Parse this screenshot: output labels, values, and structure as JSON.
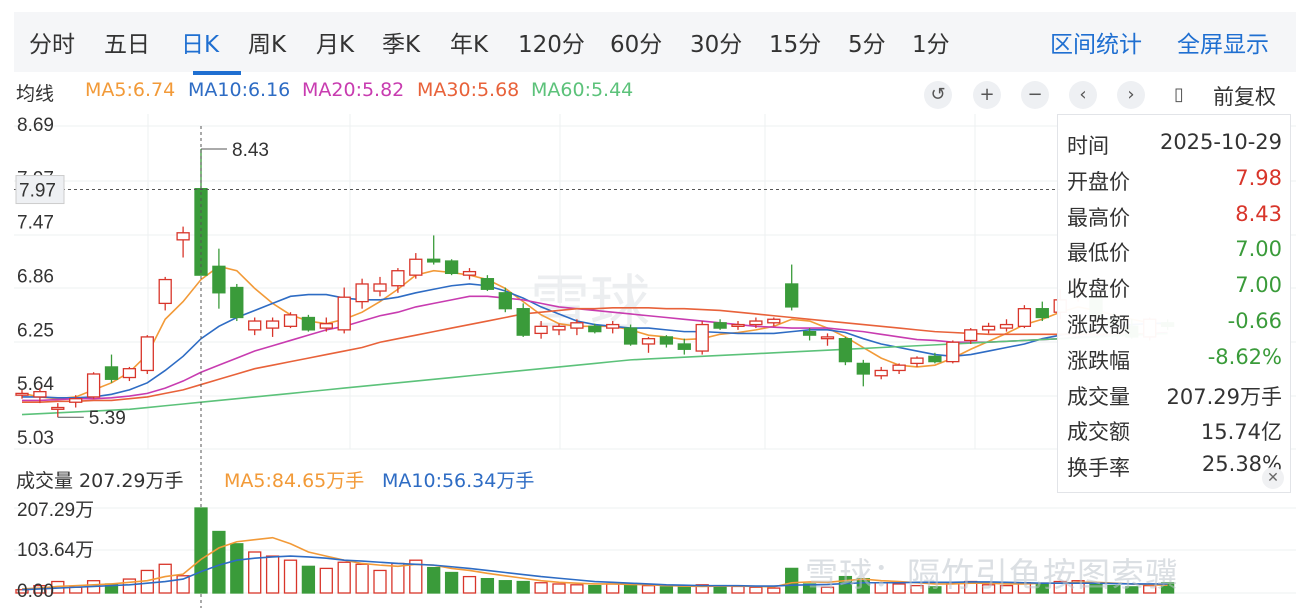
{
  "tabs": [
    "分时",
    "五日",
    "日K",
    "周K",
    "月K",
    "季K",
    "年K",
    "120分",
    "60分",
    "30分",
    "15分",
    "5分",
    "1分"
  ],
  "active_tab": "日K",
  "right_tabs": [
    "区间统计",
    "全屏显示"
  ],
  "ma_line": {
    "label": "均线",
    "ma5": "MA5:6.74",
    "ma10": "MA10:6.16",
    "ma20": "MA20:5.82",
    "ma30": "MA30:5.68",
    "ma60": "MA60:5.44"
  },
  "controls": [
    "undo-icon",
    "zoom-in-icon",
    "zoom-out-icon",
    "chevron-left-icon",
    "chevron-right-icon",
    "candle-icon"
  ],
  "adjust_label": "前复权",
  "volume_row": {
    "label": "成交量 207.29万手",
    "ma5": "MA5:84.65万手",
    "ma10": "MA10:56.34万手"
  },
  "info_panel": {
    "rows": [
      {
        "k": "时间",
        "v": "2025-10-29",
        "c": "#333333"
      },
      {
        "k": "开盘价",
        "v": "7.98",
        "c": "#d8352a"
      },
      {
        "k": "最高价",
        "v": "8.43",
        "c": "#d8352a"
      },
      {
        "k": "最低价",
        "v": "7.00",
        "c": "#3a9b3a"
      },
      {
        "k": "收盘价",
        "v": "7.00",
        "c": "#3a9b3a"
      },
      {
        "k": "涨跌额",
        "v": "-0.66",
        "c": "#3a9b3a"
      },
      {
        "k": "涨跌幅",
        "v": "-8.62%",
        "c": "#3a9b3a"
      },
      {
        "k": "成交量",
        "v": "207.29万手",
        "c": "#333333"
      },
      {
        "k": "成交额",
        "v": "15.74亿",
        "c": "#333333"
      },
      {
        "k": "换手率",
        "v": "25.38%",
        "c": "#333333"
      }
    ]
  },
  "watermark": "雪球：隔竹引龟按图索骥",
  "watermark_logo": "雪球",
  "colors": {
    "up": "#d8352a",
    "down": "#3a9b3a",
    "accent": "#1f6fd1",
    "ma5": "#f29a38",
    "ma10": "#2e6cc4",
    "ma20": "#c83cb0",
    "ma30": "#e8623a",
    "ma60": "#5cc27a"
  },
  "chart_data": {
    "type": "candlestick",
    "price_axis": {
      "ticks": [
        8.69,
        7.97,
        7.47,
        6.86,
        6.25,
        5.64,
        5.03
      ],
      "ylim": [
        5.03,
        8.69
      ]
    },
    "volume_axis": {
      "ticks": [
        "207.29万",
        "103.64万",
        "0.00"
      ],
      "ylim": [
        0,
        207.29
      ]
    },
    "annotations": {
      "max_label": "8.43",
      "min_label": "5.39",
      "crosshair_price": "7.97"
    },
    "candles": [
      [
        5.64,
        5.7,
        5.6,
        5.66
      ],
      [
        5.62,
        5.72,
        5.55,
        5.68
      ],
      [
        5.48,
        5.55,
        5.39,
        5.5
      ],
      [
        5.56,
        5.64,
        5.5,
        5.6
      ],
      [
        5.62,
        5.9,
        5.6,
        5.88
      ],
      [
        5.96,
        6.1,
        5.78,
        5.82
      ],
      [
        5.84,
        5.96,
        5.8,
        5.94
      ],
      [
        5.92,
        6.32,
        5.88,
        6.3
      ],
      [
        6.68,
        6.98,
        6.6,
        6.95
      ],
      [
        7.4,
        7.55,
        7.2,
        7.48
      ],
      [
        7.98,
        8.43,
        7.0,
        7.0
      ],
      [
        7.1,
        7.3,
        6.62,
        6.8
      ],
      [
        6.86,
        6.9,
        6.48,
        6.52
      ],
      [
        6.38,
        6.52,
        6.32,
        6.48
      ],
      [
        6.4,
        6.52,
        6.3,
        6.48
      ],
      [
        6.42,
        6.58,
        6.4,
        6.55
      ],
      [
        6.52,
        6.55,
        6.36,
        6.38
      ],
      [
        6.4,
        6.52,
        6.36,
        6.45
      ],
      [
        6.38,
        6.86,
        6.34,
        6.75
      ],
      [
        6.7,
        6.96,
        6.62,
        6.9
      ],
      [
        6.82,
        6.98,
        6.76,
        6.9
      ],
      [
        6.88,
        7.08,
        6.8,
        7.05
      ],
      [
        7.0,
        7.25,
        6.96,
        7.18
      ],
      [
        7.18,
        7.45,
        7.12,
        7.15
      ],
      [
        7.16,
        7.18,
        7.0,
        7.02
      ],
      [
        7.0,
        7.08,
        6.95,
        7.04
      ],
      [
        6.96,
        7.0,
        6.82,
        6.84
      ],
      [
        6.8,
        6.86,
        6.58,
        6.62
      ],
      [
        6.62,
        6.68,
        6.3,
        6.32
      ],
      [
        6.34,
        6.48,
        6.28,
        6.42
      ],
      [
        6.38,
        6.45,
        6.32,
        6.42
      ],
      [
        6.4,
        6.5,
        6.32,
        6.46
      ],
      [
        6.42,
        6.45,
        6.34,
        6.36
      ],
      [
        6.4,
        6.48,
        6.34,
        6.44
      ],
      [
        6.4,
        6.44,
        6.2,
        6.22
      ],
      [
        6.22,
        6.3,
        6.12,
        6.28
      ],
      [
        6.3,
        6.32,
        6.18,
        6.22
      ],
      [
        6.22,
        6.28,
        6.1,
        6.16
      ],
      [
        6.14,
        6.48,
        6.1,
        6.44
      ],
      [
        6.46,
        6.5,
        6.38,
        6.4
      ],
      [
        6.42,
        6.48,
        6.38,
        6.44
      ],
      [
        6.44,
        6.52,
        6.4,
        6.48
      ],
      [
        6.46,
        6.52,
        6.42,
        6.5
      ],
      [
        6.9,
        7.12,
        6.6,
        6.64
      ],
      [
        6.36,
        6.4,
        6.26,
        6.32
      ],
      [
        6.28,
        6.34,
        6.2,
        6.3
      ],
      [
        6.28,
        6.3,
        5.98,
        6.02
      ],
      [
        6.0,
        6.04,
        5.74,
        5.88
      ],
      [
        5.86,
        5.96,
        5.82,
        5.92
      ],
      [
        5.92,
        6.0,
        5.88,
        5.98
      ],
      [
        6.0,
        6.08,
        5.96,
        6.06
      ],
      [
        6.08,
        6.12,
        6.0,
        6.02
      ],
      [
        6.02,
        6.26,
        6.0,
        6.24
      ],
      [
        6.26,
        6.4,
        6.22,
        6.38
      ],
      [
        6.38,
        6.46,
        6.34,
        6.42
      ],
      [
        6.4,
        6.5,
        6.36,
        6.44
      ],
      [
        6.42,
        6.66,
        6.4,
        6.62
      ],
      [
        6.62,
        6.7,
        6.48,
        6.52
      ],
      [
        6.58,
        6.84,
        6.5,
        6.72
      ],
      [
        6.8,
        6.96,
        6.7,
        6.92
      ],
      [
        6.76,
        6.8,
        6.46,
        6.52
      ],
      [
        6.5,
        6.58,
        6.42,
        6.44
      ],
      [
        6.42,
        6.5,
        6.28,
        6.3
      ],
      [
        6.3,
        6.52,
        6.26,
        6.5
      ],
      [
        6.46,
        6.5,
        6.38,
        6.42
      ]
    ],
    "volumes": [
      8,
      18,
      28,
      14,
      30,
      22,
      34,
      55,
      70,
      42,
      207.29,
      150,
      120,
      100,
      90,
      80,
      65,
      60,
      75,
      70,
      55,
      72,
      80,
      62,
      50,
      40,
      35,
      30,
      28,
      25,
      22,
      20,
      18,
      22,
      20,
      18,
      15,
      14,
      20,
      18,
      16,
      14,
      12,
      60,
      22,
      14,
      40,
      35,
      25,
      22,
      18,
      15,
      24,
      28,
      20,
      18,
      25,
      22,
      28,
      30,
      22,
      18,
      15,
      18,
      25
    ],
    "ma_series": {
      "MA5": [
        5.66,
        5.62,
        5.6,
        5.62,
        5.7,
        5.78,
        5.9,
        6.1,
        6.5,
        6.7,
        6.95,
        7.1,
        7.05,
        6.85,
        6.68,
        6.55,
        6.48,
        6.45,
        6.5,
        6.58,
        6.7,
        6.84,
        7.0,
        7.05,
        7.03,
        7.0,
        6.95,
        6.85,
        6.7,
        6.55,
        6.45,
        6.42,
        6.42,
        6.42,
        6.38,
        6.32,
        6.3,
        6.27,
        6.28,
        6.33,
        6.35,
        6.38,
        6.42,
        6.5,
        6.48,
        6.4,
        6.3,
        6.18,
        6.06,
        5.98,
        5.96,
        5.98,
        6.06,
        6.16,
        6.25,
        6.34,
        6.44,
        6.5,
        6.58,
        6.64,
        6.6,
        6.55,
        6.5,
        6.46,
        6.44
      ],
      "MA10": [
        5.62,
        5.62,
        5.61,
        5.61,
        5.62,
        5.65,
        5.7,
        5.78,
        5.92,
        6.08,
        6.28,
        6.42,
        6.52,
        6.6,
        6.68,
        6.76,
        6.78,
        6.78,
        6.74,
        6.72,
        6.72,
        6.75,
        6.8,
        6.84,
        6.88,
        6.9,
        6.88,
        6.82,
        6.74,
        6.64,
        6.56,
        6.48,
        6.44,
        6.42,
        6.4,
        6.4,
        6.38,
        6.36,
        6.36,
        6.35,
        6.34,
        6.34,
        6.34,
        6.36,
        6.38,
        6.38,
        6.35,
        6.28,
        6.22,
        6.18,
        6.14,
        6.1,
        6.08,
        6.1,
        6.14,
        6.18,
        6.22,
        6.28,
        6.32,
        6.36,
        6.4,
        6.42,
        6.44,
        6.45,
        6.46
      ],
      "MA20": [
        5.58,
        5.58,
        5.59,
        5.6,
        5.6,
        5.61,
        5.63,
        5.66,
        5.72,
        5.8,
        5.9,
        5.98,
        6.06,
        6.14,
        6.2,
        6.26,
        6.32,
        6.38,
        6.42,
        6.48,
        6.54,
        6.58,
        6.64,
        6.68,
        6.72,
        6.76,
        6.76,
        6.74,
        6.72,
        6.68,
        6.64,
        6.62,
        6.6,
        6.58,
        6.56,
        6.54,
        6.52,
        6.5,
        6.48,
        6.46,
        6.44,
        6.42,
        6.41,
        6.4,
        6.4,
        6.4,
        6.38,
        6.36,
        6.33,
        6.3,
        6.27,
        6.26,
        6.24,
        6.24,
        6.24,
        6.25,
        6.26,
        6.27,
        6.28,
        6.3,
        6.31,
        6.32,
        6.33,
        6.34,
        6.35
      ],
      "MA30": [
        5.56,
        5.56,
        5.57,
        5.57,
        5.58,
        5.58,
        5.6,
        5.62,
        5.66,
        5.7,
        5.76,
        5.82,
        5.88,
        5.94,
        5.98,
        6.02,
        6.06,
        6.1,
        6.14,
        6.18,
        6.24,
        6.28,
        6.32,
        6.36,
        6.4,
        6.44,
        6.48,
        6.52,
        6.56,
        6.58,
        6.6,
        6.62,
        6.62,
        6.63,
        6.63,
        6.63,
        6.62,
        6.62,
        6.61,
        6.6,
        6.58,
        6.56,
        6.54,
        6.52,
        6.5,
        6.48,
        6.46,
        6.44,
        6.42,
        6.4,
        6.38,
        6.36,
        6.35,
        6.34,
        6.33,
        6.33,
        6.33,
        6.33,
        6.33,
        6.33,
        6.33,
        6.33,
        6.33,
        6.34,
        6.34
      ],
      "MA60": [
        5.42,
        5.43,
        5.44,
        5.45,
        5.46,
        5.47,
        5.48,
        5.5,
        5.52,
        5.54,
        5.56,
        5.58,
        5.6,
        5.62,
        5.64,
        5.66,
        5.68,
        5.7,
        5.72,
        5.74,
        5.76,
        5.78,
        5.8,
        5.82,
        5.84,
        5.86,
        5.88,
        5.9,
        5.92,
        5.94,
        5.96,
        5.98,
        6.0,
        6.02,
        6.04,
        6.05,
        6.06,
        6.07,
        6.08,
        6.09,
        6.1,
        6.11,
        6.12,
        6.13,
        6.14,
        6.15,
        6.16,
        6.17,
        6.18,
        6.19,
        6.2,
        6.21,
        6.22,
        6.23,
        6.24,
        6.25,
        6.26,
        6.27,
        6.28,
        6.29,
        6.3,
        6.31,
        6.32,
        6.33,
        6.34
      ]
    },
    "volume_ma": {
      "MA5": [
        10,
        12,
        16,
        18,
        20,
        22,
        26,
        30,
        40,
        46,
        82,
        110,
        125,
        130,
        135,
        120,
        100,
        90,
        80,
        72,
        68,
        65,
        70,
        68,
        60,
        55,
        48,
        42,
        36,
        30,
        26,
        24,
        22,
        22,
        21,
        20,
        18,
        17,
        16,
        17,
        17,
        16,
        15,
        25,
        27,
        26,
        30,
        34,
        30,
        28,
        25,
        22,
        22,
        24,
        24,
        22,
        22,
        24,
        24,
        26,
        26,
        24,
        22,
        20,
        19
      ],
      "MA10": [
        8,
        10,
        12,
        14,
        16,
        18,
        20,
        24,
        28,
        34,
        52,
        68,
        80,
        85,
        88,
        90,
        88,
        85,
        80,
        78,
        75,
        72,
        70,
        68,
        64,
        60,
        55,
        50,
        45,
        40,
        36,
        32,
        28,
        26,
        24,
        22,
        20,
        19,
        18,
        18,
        18,
        17,
        17,
        19,
        20,
        21,
        23,
        25,
        25,
        25,
        26,
        26,
        26,
        27,
        27,
        26,
        25,
        24,
        24,
        24,
        24,
        23,
        22,
        22,
        22
      ]
    }
  }
}
